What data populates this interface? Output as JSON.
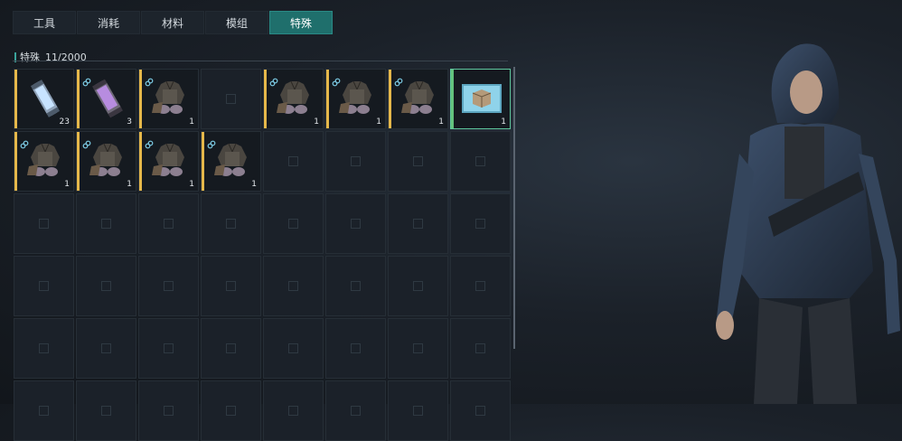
{
  "tabs": [
    {
      "label": "工具",
      "active": false
    },
    {
      "label": "消耗",
      "active": false
    },
    {
      "label": "材料",
      "active": false
    },
    {
      "label": "模组",
      "active": false
    },
    {
      "label": "特殊",
      "active": true
    }
  ],
  "section": {
    "title": "特殊",
    "count": "11/2000"
  },
  "colors": {
    "accent": "#1f6f6c",
    "rarity_gold": "#e6b84a",
    "rarity_green": "#63c27c"
  },
  "inventory": {
    "items": [
      {
        "icon": "battery-canister-icon",
        "qty": "23",
        "rarity": "gold",
        "linked": false
      },
      {
        "icon": "purple-canister-icon",
        "qty": "3",
        "rarity": "gold",
        "linked": true
      },
      {
        "icon": "armor-outfit-icon",
        "qty": "1",
        "rarity": "gold",
        "linked": true
      },
      {
        "icon": "empty-slot",
        "qty": "",
        "rarity": "",
        "linked": false
      },
      {
        "icon": "armor-outfit-icon",
        "qty": "1",
        "rarity": "gold",
        "linked": true
      },
      {
        "icon": "armor-outfit-icon",
        "qty": "1",
        "rarity": "gold",
        "linked": true
      },
      {
        "icon": "armor-outfit-icon",
        "qty": "1",
        "rarity": "gold",
        "linked": true
      },
      {
        "icon": "supply-crate-icon",
        "qty": "1",
        "rarity": "green",
        "linked": false
      },
      {
        "icon": "armor-outfit-icon",
        "qty": "1",
        "rarity": "gold",
        "linked": true
      },
      {
        "icon": "armor-outfit-icon",
        "qty": "1",
        "rarity": "gold",
        "linked": true
      },
      {
        "icon": "armor-outfit-icon",
        "qty": "1",
        "rarity": "gold",
        "linked": true
      },
      {
        "icon": "armor-outfit-icon",
        "qty": "1",
        "rarity": "gold",
        "linked": true
      }
    ],
    "total_slots": 48
  }
}
